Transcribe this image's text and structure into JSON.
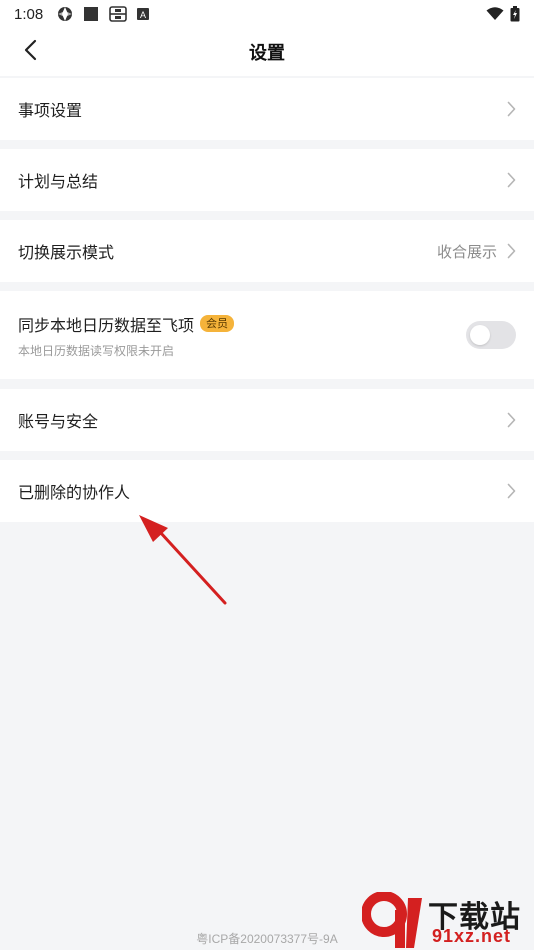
{
  "status_bar": {
    "time": "1:08",
    "icons_left": [
      "aperture-icon",
      "square-icon",
      "tray-icon",
      "letter-a-icon"
    ],
    "icons_right": [
      "wifi-icon",
      "battery-icon"
    ]
  },
  "header": {
    "title": "设置",
    "back_icon": "chevron-left-icon"
  },
  "items": {
    "events": {
      "label": "事项设置"
    },
    "plan": {
      "label": "计划与总结"
    },
    "display_mode": {
      "label": "切换展示模式",
      "value": "收合展示"
    },
    "sync": {
      "label": "同步本地日历数据至飞项",
      "badge": "会员",
      "subtitle": "本地日历数据读写权限未开启",
      "enabled": false
    },
    "account": {
      "label": "账号与安全"
    },
    "deleted_collaborators": {
      "label": "已删除的协作人"
    }
  },
  "footer": {
    "icp": "粤ICP备2020073377号-9A"
  },
  "watermark": {
    "top": "下载站",
    "bottom": "91xz.net"
  },
  "colors": {
    "background": "#f4f5f7",
    "card": "#ffffff",
    "badge": "#f5b33a",
    "annotation_arrow": "#d42020"
  }
}
